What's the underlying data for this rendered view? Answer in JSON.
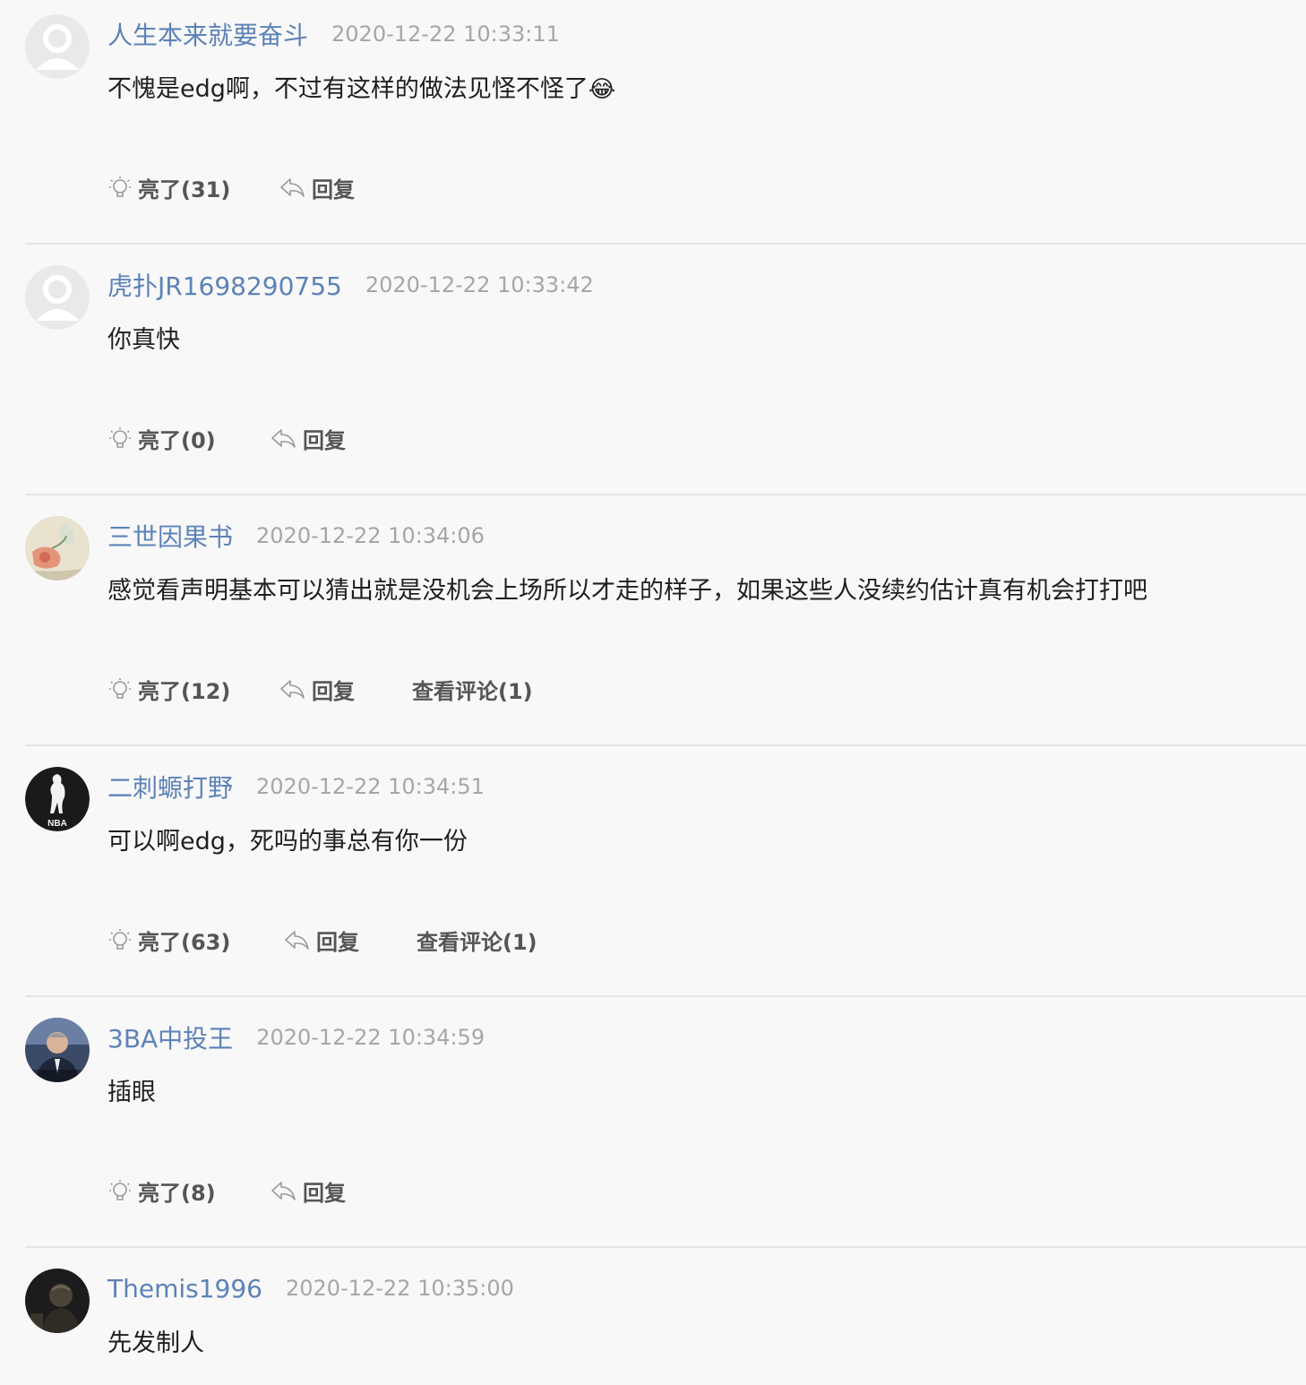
{
  "comments": [
    {
      "username": "人生本来就要奋斗",
      "time": "2020-12-22 10:33:11",
      "text": "不愧是edg啊，不过有这样的做法见怪不怪了",
      "emoji": "😂",
      "like_label": "亮了(31)",
      "reply_label": "回复",
      "avatar_icon": "default-avatar-icon"
    },
    {
      "username": "虎扑JR1698290755",
      "time": "2020-12-22 10:33:42",
      "text": "你真快",
      "like_label": "亮了(0)",
      "reply_label": "回复",
      "avatar_icon": "default-avatar-icon"
    },
    {
      "username": "三世因果书",
      "time": "2020-12-22 10:34:06",
      "text": "感觉看声明基本可以猜出就是没机会上场所以才走的样子，如果这些人没续约估计真有机会打打吧",
      "like_label": "亮了(12)",
      "reply_label": "回复",
      "view_comments_label": "查看评论(1)",
      "avatar_icon": "flower-painting-avatar"
    },
    {
      "username": "二刺螈打野",
      "time": "2020-12-22 10:34:51",
      "text": "可以啊edg，死吗的事总有你一份",
      "like_label": "亮了(63)",
      "reply_label": "回复",
      "view_comments_label": "查看评论(1)",
      "avatar_icon": "nba-logo-avatar",
      "avatar_logo_text": "NBA"
    },
    {
      "username": "3BA中投王",
      "time": "2020-12-22 10:34:59",
      "text": "插眼",
      "like_label": "亮了(8)",
      "reply_label": "回复",
      "avatar_icon": "man-in-suit-photo-avatar"
    },
    {
      "username": "Themis1996",
      "time": "2020-12-22 10:35:00",
      "text": "先发制人",
      "avatar_icon": "dark-photo-avatar"
    }
  ],
  "colors": {
    "username": "#5c82b8",
    "timestamp": "#a6a6a6",
    "background": "#f8f8f8",
    "divider": "#e4e4e4"
  }
}
